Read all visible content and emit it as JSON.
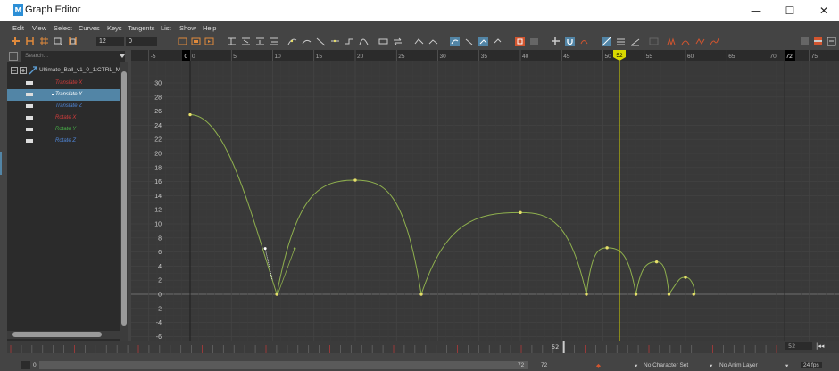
{
  "window": {
    "title": "Graph Editor",
    "app_icon": "M",
    "minimize": "—",
    "maximize": "☐",
    "close": "✕"
  },
  "menu": [
    "Edit",
    "View",
    "Select",
    "Curves",
    "Keys",
    "Tangents",
    "List",
    "Show",
    "Help"
  ],
  "toolbar": {
    "frame_value": "12",
    "key_value": "0"
  },
  "outliner": {
    "search_placeholder": "Search...",
    "node": "Ultimate_Ball_v1_0_1:CTRL_M",
    "attributes": [
      {
        "label": "Translate X",
        "color": "#d23c3c",
        "selected": false
      },
      {
        "label": "Translate Y",
        "color": "#ffffff",
        "selected": true
      },
      {
        "label": "Translate Z",
        "color": "#4f86d8",
        "selected": false
      },
      {
        "label": "Rotate X",
        "color": "#d23c3c",
        "selected": false
      },
      {
        "label": "Rotate Y",
        "color": "#49b649",
        "selected": false
      },
      {
        "label": "Rotate Z",
        "color": "#4f86d8",
        "selected": false
      }
    ]
  },
  "graph": {
    "time_ruler": [
      "-5",
      "0",
      "5",
      "10",
      "15",
      "20",
      "25",
      "30",
      "35",
      "40",
      "45",
      "50",
      "55",
      "60",
      "65",
      "70",
      "75"
    ],
    "value_labels": [
      "30",
      "28",
      "26",
      "24",
      "22",
      "20",
      "18",
      "16",
      "14",
      "12",
      "10",
      "8",
      "6",
      "4",
      "2",
      "0",
      "-2",
      "-4",
      "-6"
    ],
    "start_marker": "0",
    "end_marker": "72",
    "current_frame": "52",
    "curve_color": "#8fb04e",
    "key_color": "#e8e06a",
    "current_time_color": "#d8d800"
  },
  "chart_data": {
    "type": "line",
    "series": [
      {
        "name": "Translate Y",
        "x": [
          0,
          10.5,
          20,
          28,
          40,
          48,
          50.5,
          54,
          56.5,
          58,
          60
        ],
        "y": [
          25.5,
          0,
          16.2,
          0,
          11.6,
          0,
          6.6,
          0,
          4.6,
          0,
          2.4
        ]
      }
    ],
    "xlim": [
      -5,
      78
    ],
    "ylim": [
      -6.5,
      31
    ]
  },
  "timeslider": {
    "current_frame": "52",
    "end_frame": "52"
  },
  "bottom": {
    "start": "0",
    "end_a": "72",
    "end_b": "72",
    "character_set": "No Character Set",
    "anim_layer": "No Anim Layer",
    "fps": "24 fps"
  }
}
